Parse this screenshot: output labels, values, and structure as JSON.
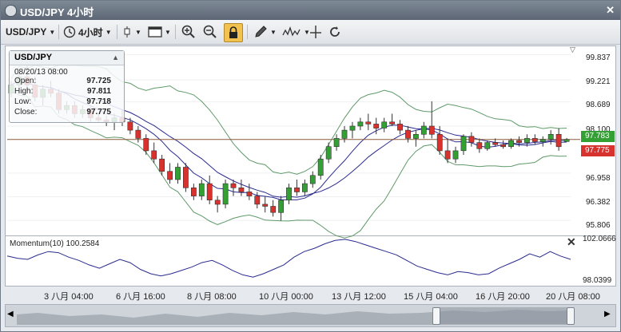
{
  "window": {
    "title": "USD/JPY 4小时",
    "close_glyph": "✕"
  },
  "toolbar": {
    "symbol": "USD/JPY",
    "timeframe": "4小时",
    "icons": [
      "clock-icon",
      "candlestick-icon",
      "chart-window-icon",
      "zoom-in-icon",
      "zoom-out-icon",
      "lock-icon",
      "pencil-icon",
      "indicator-icon",
      "crosshair-icon",
      "refresh-icon"
    ]
  },
  "info_panel": {
    "symbol": "USD/JPY",
    "datetime": "08/20/13 08:00",
    "rows": [
      {
        "key": "Open:",
        "value": "97.725"
      },
      {
        "key": "High:",
        "value": "97.811"
      },
      {
        "key": "Low:",
        "value": "97.718"
      },
      {
        "key": "Close:",
        "value": "97.775"
      }
    ]
  },
  "price_axis": [
    "99.837",
    "99.221",
    "98.689",
    "98.100",
    "96.958",
    "96.382",
    "95.806"
  ],
  "price_tags": {
    "upper": {
      "value": "97.783",
      "color": "#33a033"
    },
    "lower": {
      "value": "97.775",
      "color": "#d8322e"
    }
  },
  "momentum": {
    "label": "Momentum(10) 100.2584",
    "axis_top": "102.0666",
    "axis_bottom": "98.0399",
    "close_glyph": "✕"
  },
  "time_axis": [
    "3 八月 04:00",
    "6 八月 16:00",
    "8 八月 08:00",
    "10 八月 00:00",
    "13 八月 12:00",
    "15 八月 04:00",
    "16 八月 20:00",
    "20 八月 08:00"
  ],
  "colors": {
    "bull": "#33a033",
    "bear": "#d8322e",
    "bands": "#5f9a6a",
    "ma": "#2b2b8f",
    "price_line": "#8b5a3c"
  },
  "chart_data": {
    "type": "candlestick",
    "ylim": [
      95.5,
      100.0
    ],
    "candles": [
      [
        98.9,
        99.2,
        98.8,
        99.1
      ],
      [
        99.1,
        99.4,
        99.0,
        99.3
      ],
      [
        99.3,
        99.6,
        99.0,
        99.1
      ],
      [
        99.1,
        99.3,
        98.7,
        98.8
      ],
      [
        98.8,
        99.1,
        98.6,
        99.0
      ],
      [
        99.0,
        99.2,
        98.8,
        98.9
      ],
      [
        98.9,
        99.0,
        98.4,
        98.5
      ],
      [
        98.5,
        98.7,
        98.4,
        98.6
      ],
      [
        98.6,
        98.7,
        98.3,
        98.4
      ],
      [
        98.4,
        98.6,
        98.3,
        98.5
      ],
      [
        98.5,
        98.6,
        98.2,
        98.3
      ],
      [
        98.3,
        98.4,
        98.2,
        98.25
      ],
      [
        98.25,
        98.35,
        98.1,
        98.2
      ],
      [
        98.2,
        98.4,
        98.0,
        98.3
      ],
      [
        98.3,
        98.5,
        98.1,
        98.2
      ],
      [
        98.2,
        98.3,
        97.9,
        98.0
      ],
      [
        98.0,
        98.1,
        97.7,
        97.8
      ],
      [
        97.8,
        97.9,
        97.4,
        97.5
      ],
      [
        97.5,
        97.7,
        97.2,
        97.3
      ],
      [
        97.3,
        97.4,
        96.9,
        97.0
      ],
      [
        97.0,
        97.2,
        96.7,
        96.8
      ],
      [
        96.8,
        97.2,
        96.7,
        97.1
      ],
      [
        97.1,
        97.2,
        96.5,
        96.6
      ],
      [
        96.6,
        96.7,
        96.3,
        96.4
      ],
      [
        96.4,
        96.8,
        96.3,
        96.7
      ],
      [
        96.7,
        96.9,
        96.2,
        96.3
      ],
      [
        96.3,
        96.4,
        96.0,
        96.2
      ],
      [
        96.2,
        96.8,
        96.1,
        96.7
      ],
      [
        96.7,
        96.8,
        96.4,
        96.6
      ],
      [
        96.6,
        96.8,
        96.4,
        96.5
      ],
      [
        96.5,
        96.7,
        96.3,
        96.4
      ],
      [
        96.4,
        96.5,
        96.1,
        96.2
      ],
      [
        96.2,
        96.4,
        96.0,
        96.15
      ],
      [
        96.15,
        96.3,
        95.9,
        96.0
      ],
      [
        96.0,
        96.4,
        95.8,
        96.3
      ],
      [
        96.3,
        96.7,
        96.2,
        96.6
      ],
      [
        96.6,
        96.8,
        96.4,
        96.5
      ],
      [
        96.5,
        96.8,
        96.4,
        96.7
      ],
      [
        96.7,
        97.0,
        96.6,
        96.9
      ],
      [
        96.9,
        97.4,
        96.8,
        97.3
      ],
      [
        97.3,
        97.7,
        97.2,
        97.6
      ],
      [
        97.6,
        97.9,
        97.5,
        97.8
      ],
      [
        97.8,
        98.1,
        97.7,
        98.0
      ],
      [
        98.0,
        98.2,
        97.8,
        98.1
      ],
      [
        98.1,
        98.3,
        98.0,
        98.2
      ],
      [
        98.2,
        98.4,
        98.0,
        98.15
      ],
      [
        98.15,
        98.3,
        97.9,
        98.05
      ],
      [
        98.05,
        98.3,
        97.95,
        98.2
      ],
      [
        98.2,
        98.4,
        98.1,
        98.15
      ],
      [
        98.15,
        98.25,
        97.9,
        98.0
      ],
      [
        98.0,
        98.1,
        97.7,
        97.8
      ],
      [
        97.8,
        98.0,
        97.6,
        97.9
      ],
      [
        97.9,
        98.2,
        97.8,
        98.1
      ],
      [
        98.1,
        98.7,
        97.8,
        97.9
      ],
      [
        97.9,
        98.1,
        97.4,
        97.5
      ],
      [
        97.5,
        97.8,
        97.2,
        97.3
      ],
      [
        97.3,
        97.6,
        97.2,
        97.5
      ],
      [
        97.5,
        97.9,
        97.4,
        97.85
      ],
      [
        97.85,
        97.95,
        97.6,
        97.7
      ],
      [
        97.7,
        97.8,
        97.45,
        97.55
      ],
      [
        97.55,
        97.75,
        97.5,
        97.7
      ],
      [
        97.7,
        97.8,
        97.6,
        97.65
      ],
      [
        97.65,
        97.75,
        97.55,
        97.6
      ],
      [
        97.6,
        97.8,
        97.55,
        97.75
      ],
      [
        97.75,
        97.85,
        97.6,
        97.7
      ],
      [
        97.7,
        97.9,
        97.6,
        97.8
      ],
      [
        97.8,
        97.9,
        97.65,
        97.72
      ],
      [
        97.72,
        97.85,
        97.6,
        97.78
      ],
      [
        97.78,
        98.0,
        97.65,
        97.9
      ],
      [
        97.9,
        98.05,
        97.5,
        97.6
      ],
      [
        97.725,
        97.811,
        97.718,
        97.775
      ]
    ],
    "momentum": [
      100.5,
      100.3,
      100.2,
      100.6,
      100.9,
      100.8,
      100.4,
      100.1,
      99.7,
      99.4,
      99.8,
      100.2,
      99.9,
      99.3,
      98.9,
      98.7,
      98.9,
      99.2,
      99.5,
      99.9,
      100.1,
      99.7,
      99.2,
      98.8,
      98.6,
      98.9,
      99.3,
      99.7,
      100.4,
      100.9,
      101.2,
      101.6,
      101.9,
      102.0,
      101.8,
      101.5,
      101.2,
      100.9,
      100.6,
      100.1,
      99.6,
      99.3,
      99.0,
      98.8,
      99.1,
      99.0,
      98.8,
      98.9,
      99.4,
      99.8,
      100.2,
      100.7,
      100.4,
      100.9,
      100.5,
      100.2
    ]
  }
}
